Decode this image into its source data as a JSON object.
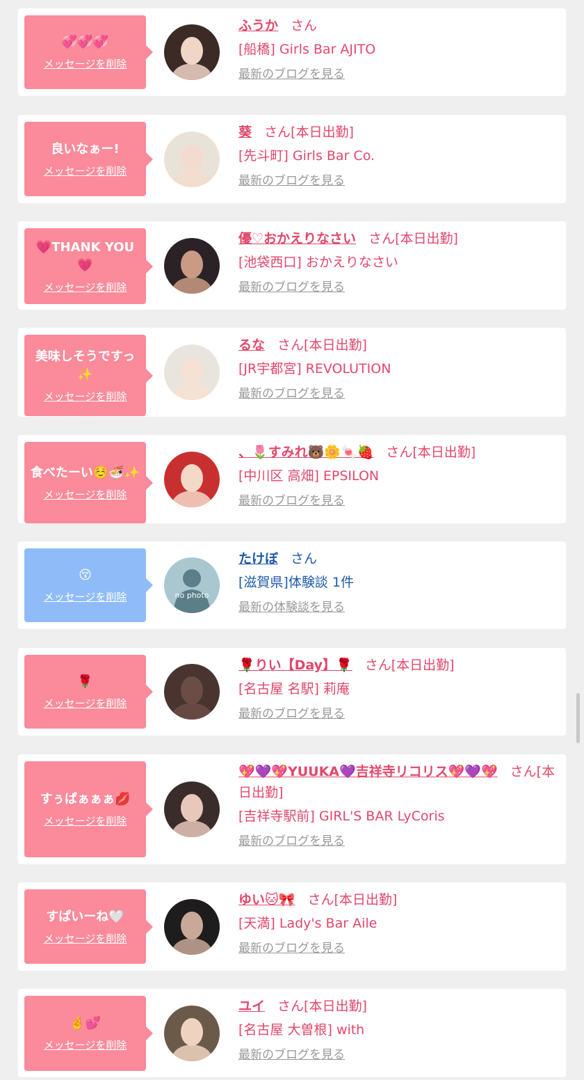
{
  "colors": {
    "pink_bubble": "#fb8a9a",
    "blue_bubble": "#8fbcf8",
    "name_pink": "#e2476b",
    "name_blue": "#1e5aa8",
    "link_gray": "#999999"
  },
  "entries": [
    {
      "gender": "female",
      "message": "💞💞💞",
      "delete_label": "メッセージを削除",
      "name": "ふうか",
      "honorific": "さん",
      "status": "",
      "shop": "[船橋] Girls Bar AJITO",
      "link": "最新のブログを見る",
      "avatar_icon": "profile-photo"
    },
    {
      "gender": "female",
      "message": "良いなぁー!",
      "delete_label": "メッセージを削除",
      "name": "葵",
      "honorific": "さん",
      "status": "[本日出勤]",
      "shop": "[先斗町] Girls Bar Co.",
      "link": "最新のブログを見る",
      "avatar_icon": "profile-photo"
    },
    {
      "gender": "female",
      "message": "💗THANK YOU💗",
      "delete_label": "メッセージを削除",
      "name": "優♡おかえりなさい",
      "honorific": "さん",
      "status": "[本日出勤]",
      "shop": "[池袋西口] おかえりなさい",
      "link": "最新のブログを見る",
      "avatar_icon": "profile-photo"
    },
    {
      "gender": "female",
      "message": "美味しそうですっ✨",
      "delete_label": "メッセージを削除",
      "name": "るな",
      "honorific": "さん",
      "status": "[本日出勤]",
      "shop": "[JR宇都宮] REVOLUTION",
      "link": "最新のブログを見る",
      "avatar_icon": "profile-photo"
    },
    {
      "gender": "female",
      "message": "食べたーい☺️🍜✨",
      "delete_label": "メッセージを削除",
      "name": "、🌷すみれ🐻🌼🍬🍓",
      "honorific": "さん",
      "status": "[本日出勤]",
      "shop": "[中川区 高畑] EPSILON",
      "link": "最新のブログを見る",
      "avatar_icon": "profile-photo"
    },
    {
      "gender": "male",
      "message": "😚",
      "delete_label": "メッセージを削除",
      "name": "たけぼ",
      "honorific": "さん",
      "status": "",
      "shop": "[滋賀県]体験談 1件",
      "link": "最新の体験談を見る",
      "avatar_icon": "no-photo",
      "avatar_text": "no photo"
    },
    {
      "gender": "female",
      "message": "🌹",
      "delete_label": "メッセージを削除",
      "name": "🌹りい【Day】🌹",
      "honorific": "さん",
      "status": "[本日出勤]",
      "shop": "[名古屋 名駅] 莉庵",
      "link": "最新のブログを見る",
      "avatar_icon": "profile-photo"
    },
    {
      "gender": "female",
      "message": "すぅぱぁぁぁ💋",
      "delete_label": "メッセージを削除",
      "name": "💖💜💖YUUKA💜吉祥寺リコリス💖💜💖",
      "honorific": "さん",
      "status": "[本日出勤]",
      "shop": "[吉祥寺駅前] GIRL'S BAR LyCoris",
      "link": "最新のブログを見る",
      "avatar_icon": "profile-photo"
    },
    {
      "gender": "female",
      "message": "すぱいーね🤍",
      "delete_label": "メッセージを削除",
      "name": "ゆい🐱🎀",
      "honorific": "さん",
      "status": "[本日出勤]",
      "shop": "[天満] Lady's Bar Aile",
      "link": "最新のブログを見る",
      "avatar_icon": "profile-photo"
    },
    {
      "gender": "female",
      "message": "🤞💕",
      "delete_label": "メッセージを削除",
      "name": "ユイ",
      "honorific": "さん",
      "status": "[本日出勤]",
      "shop": "[名古屋 大曽根] with",
      "link": "最新のブログを見る",
      "avatar_icon": "profile-photo"
    }
  ]
}
